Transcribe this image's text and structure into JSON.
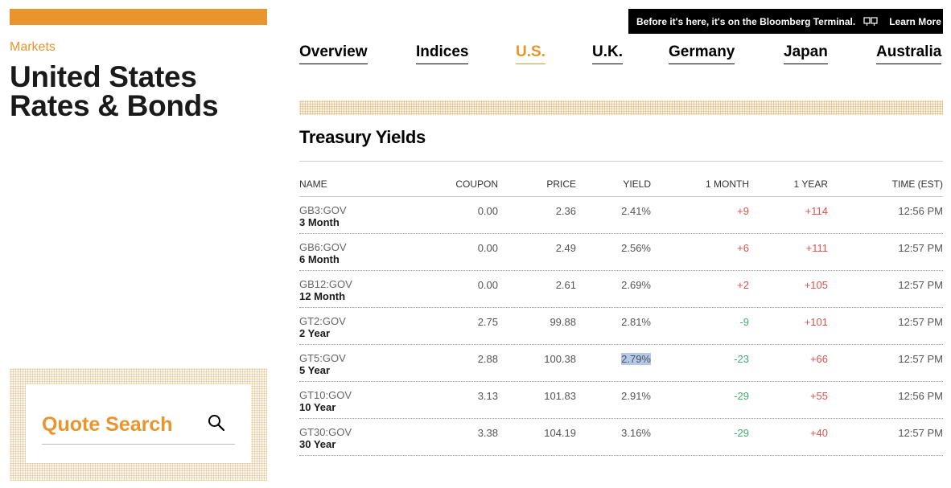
{
  "sidebar": {
    "section_label": "Markets",
    "title_line1": "United States",
    "title_line2": "Rates & Bonds",
    "quote_search_label": "Quote Search"
  },
  "promo": {
    "text": "Before it's here, it's on the Bloomberg Terminal.",
    "link": "Learn More"
  },
  "nav": {
    "items": [
      "Overview",
      "Indices",
      "U.S.",
      "U.K.",
      "Germany",
      "Japan",
      "Australia"
    ],
    "active": "U.S."
  },
  "section_title": "Treasury Yields",
  "table": {
    "headers": [
      "NAME",
      "COUPON",
      "PRICE",
      "YIELD",
      "1 MONTH",
      "1 YEAR",
      "TIME (EST)"
    ],
    "rows": [
      {
        "symbol": "GB3:GOV",
        "name": "3 Month",
        "coupon": "0.00",
        "price": "2.36",
        "yield": "2.41%",
        "month": "+9",
        "year": "+114",
        "time": "12:56 PM"
      },
      {
        "symbol": "GB6:GOV",
        "name": "6 Month",
        "coupon": "0.00",
        "price": "2.49",
        "yield": "2.56%",
        "month": "+6",
        "year": "+111",
        "time": "12:57 PM"
      },
      {
        "symbol": "GB12:GOV",
        "name": "12 Month",
        "coupon": "0.00",
        "price": "2.61",
        "yield": "2.69%",
        "month": "+2",
        "year": "+105",
        "time": "12:57 PM"
      },
      {
        "symbol": "GT2:GOV",
        "name": "2 Year",
        "coupon": "2.75",
        "price": "99.88",
        "yield": "2.81%",
        "month": "-9",
        "year": "+101",
        "time": "12:57 PM"
      },
      {
        "symbol": "GT5:GOV",
        "name": "5 Year",
        "coupon": "2.88",
        "price": "100.38",
        "yield": "2.79%",
        "month": "-23",
        "year": "+66",
        "time": "12:57 PM"
      },
      {
        "symbol": "GT10:GOV",
        "name": "10 Year",
        "coupon": "3.13",
        "price": "101.83",
        "yield": "2.91%",
        "month": "-29",
        "year": "+55",
        "time": "12:56 PM"
      },
      {
        "symbol": "GT30:GOV",
        "name": "30 Year",
        "coupon": "3.38",
        "price": "104.19",
        "yield": "3.16%",
        "month": "-29",
        "year": "+40",
        "time": "12:57 PM"
      }
    ]
  },
  "colors": {
    "accent": "#e8952e",
    "positive": "#d9534f",
    "negative": "#3fae6e",
    "highlight": "#b4c8ec"
  }
}
